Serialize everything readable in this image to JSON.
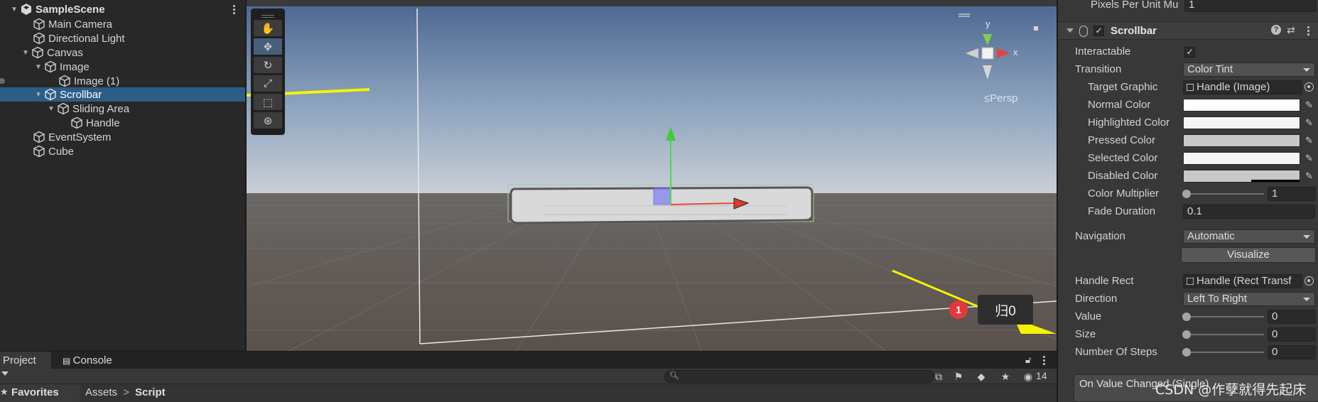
{
  "hierarchy": {
    "scene_name": "SampleScene",
    "items": [
      {
        "label": "Main Camera"
      },
      {
        "label": "Directional Light"
      },
      {
        "label": "Canvas"
      },
      {
        "label": "Image"
      },
      {
        "label": "Image (1)"
      },
      {
        "label": "Scrollbar"
      },
      {
        "label": "Sliding Area"
      },
      {
        "label": "Handle"
      },
      {
        "label": "EventSystem"
      },
      {
        "label": "Cube"
      }
    ]
  },
  "scene": {
    "persp_label": "≤Persp",
    "gizmo_axes": {
      "y": "y",
      "x": "x"
    },
    "badge_count": "1",
    "tooltip_text": "归0",
    "tools": [
      "hand-tool",
      "move-tool",
      "rotate-tool",
      "scale-tool",
      "rect-tool",
      "transform-tool"
    ]
  },
  "inspector": {
    "pixels_per_unit_label": "Pixels Per Unit Mu",
    "pixels_per_unit_value": "1",
    "component_title": "Scrollbar",
    "interactable_label": "Interactable",
    "interactable_check": "✓",
    "transition_label": "Transition",
    "transition_value": "Color Tint",
    "target_graphic_label": "Target Graphic",
    "target_graphic_value": "Handle (Image)",
    "normal_color_label": "Normal Color",
    "highlighted_color_label": "Highlighted Color",
    "pressed_color_label": "Pressed Color",
    "selected_color_label": "Selected Color",
    "disabled_color_label": "Disabled Color",
    "color_multiplier_label": "Color Multiplier",
    "color_multiplier_value": "1",
    "fade_duration_label": "Fade Duration",
    "fade_duration_value": "0.1",
    "navigation_label": "Navigation",
    "navigation_value": "Automatic",
    "visualize_label": "Visualize",
    "handle_rect_label": "Handle Rect",
    "handle_rect_value": "Handle (Rect Transf",
    "direction_label": "Direction",
    "direction_value": "Left To Right",
    "value_label": "Value",
    "value_value": "0",
    "size_label": "Size",
    "size_value": "0",
    "steps_label": "Number Of Steps",
    "steps_value": "0",
    "event_label": "On Value Changed (Single)",
    "colors": {
      "normal": "#ffffff",
      "highlighted": "#f5f5f5",
      "pressed": "#c8c8c8",
      "selected": "#f5f5f5",
      "disabled": "#c8c8c8"
    }
  },
  "bottom": {
    "tab_project": "Project",
    "tab_console": "Console",
    "favorites_label": "Favorites",
    "breadcrumb_assets": "Assets",
    "breadcrumb_sep": ">",
    "breadcrumb_script": "Script",
    "hidden_count": "14"
  },
  "watermark": "CSDN @作孽就得先起床",
  "colors": {
    "selection": "#2c5d87",
    "annotation_arrow": "#f4f400",
    "badge": "#e5383b"
  }
}
